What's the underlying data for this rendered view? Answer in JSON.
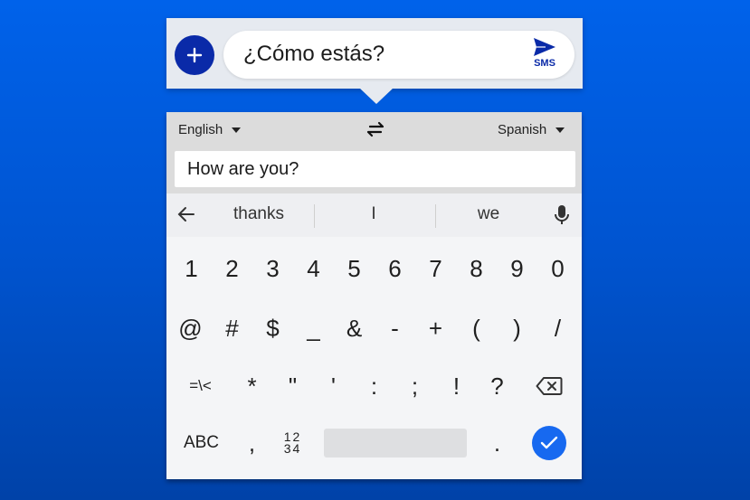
{
  "compose": {
    "add_label": "+",
    "message_text": "¿Cómo estás?",
    "send_label": "SMS"
  },
  "translate": {
    "source_lang": "English",
    "target_lang": "Spanish",
    "input_value": "How are you?"
  },
  "suggestions": [
    "thanks",
    "I",
    "we"
  ],
  "keys": {
    "row1": [
      "1",
      "2",
      "3",
      "4",
      "5",
      "6",
      "7",
      "8",
      "9",
      "0"
    ],
    "row2": [
      "@",
      "#",
      "$",
      "_",
      "&",
      "-",
      "+",
      "(",
      ")",
      "/"
    ],
    "row3": [
      "=\\<",
      "*",
      "\"",
      "'",
      ":",
      ";",
      "!",
      "?"
    ],
    "row4": {
      "abc": "ABC",
      "comma": ",",
      "numpad_top": "12",
      "numpad_bottom": "34",
      "period": "."
    }
  },
  "colors": {
    "accent_dark": "#0a2aa8",
    "done_blue": "#1769f0",
    "background_top": "#0062ea",
    "background_bottom": "#0042a8"
  }
}
